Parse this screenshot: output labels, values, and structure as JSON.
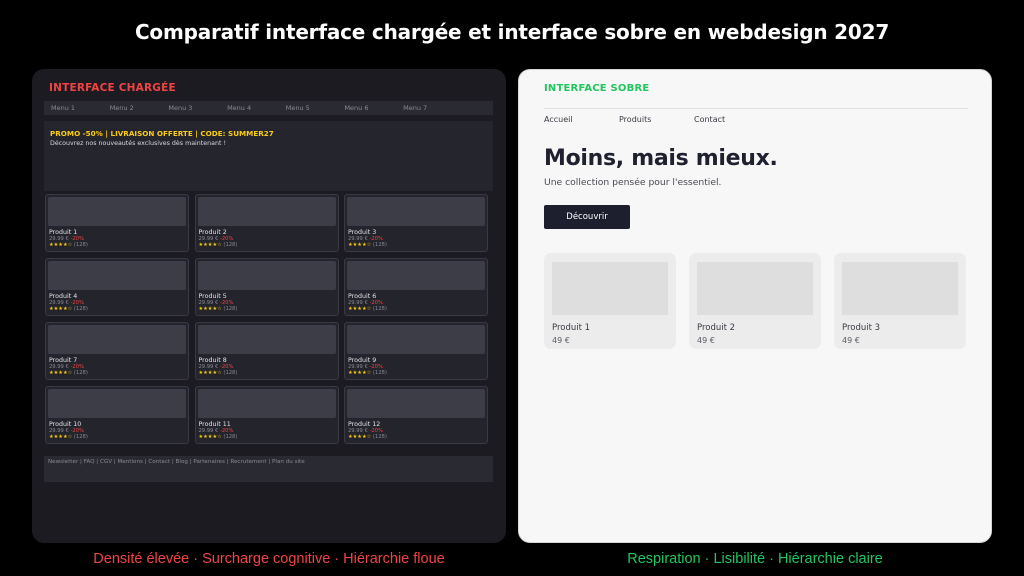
{
  "title": "Comparatif interface chargée et interface sobre en webdesign 2027",
  "left": {
    "heading": "INTERFACE CHARGÉE",
    "menu": [
      "Menu 1",
      "Menu 2",
      "Menu 3",
      "Menu 4",
      "Menu 5",
      "Menu 6",
      "Menu 7"
    ],
    "promo": {
      "title": "PROMO -50% | LIVRAISON OFFERTE | CODE: SUMMER27",
      "subtitle": "Découvrez nos nouveautés exclusives dès maintenant !"
    },
    "products": [
      {
        "name": "Produit 1",
        "price": "29.99 €",
        "discount": "-20%",
        "stars": "★★★★☆",
        "reviews": "(128)"
      },
      {
        "name": "Produit 2",
        "price": "29.99 €",
        "discount": "-20%",
        "stars": "★★★★☆",
        "reviews": "(128)"
      },
      {
        "name": "Produit 3",
        "price": "29.99 €",
        "discount": "-20%",
        "stars": "★★★★☆",
        "reviews": "(128)"
      },
      {
        "name": "Produit 4",
        "price": "29.99 €",
        "discount": "-20%",
        "stars": "★★★★☆",
        "reviews": "(128)"
      },
      {
        "name": "Produit 5",
        "price": "29.99 €",
        "discount": "-20%",
        "stars": "★★★★☆",
        "reviews": "(128)"
      },
      {
        "name": "Produit 6",
        "price": "29.99 €",
        "discount": "-20%",
        "stars": "★★★★☆",
        "reviews": "(128)"
      },
      {
        "name": "Produit 7",
        "price": "29.99 €",
        "discount": "-20%",
        "stars": "★★★★☆",
        "reviews": "(128)"
      },
      {
        "name": "Produit 8",
        "price": "29.99 €",
        "discount": "-20%",
        "stars": "★★★★☆",
        "reviews": "(128)"
      },
      {
        "name": "Produit 9",
        "price": "29.99 €",
        "discount": "-20%",
        "stars": "★★★★☆",
        "reviews": "(128)"
      },
      {
        "name": "Produit 10",
        "price": "29.99 €",
        "discount": "-20%",
        "stars": "★★★★☆",
        "reviews": "(128)"
      },
      {
        "name": "Produit 11",
        "price": "29.99 €",
        "discount": "-20%",
        "stars": "★★★★☆",
        "reviews": "(128)"
      },
      {
        "name": "Produit 12",
        "price": "29.99 €",
        "discount": "-20%",
        "stars": "★★★★☆",
        "reviews": "(128)"
      }
    ],
    "footer": "Newsletter | FAQ | CGV | Mentions | Contact | Blog | Partenaires | Recrutement | Plan du site",
    "caption": "Densité élevée · Surcharge cognitive · Hiérarchie floue"
  },
  "right": {
    "heading": "INTERFACE SOBRE",
    "nav": [
      "Accueil",
      "Produits",
      "Contact"
    ],
    "hero_title": "Moins, mais mieux.",
    "hero_subtitle": "Une collection pensée pour l'essentiel.",
    "cta_label": "Découvrir",
    "products": [
      {
        "name": "Produit 1",
        "price": "49 €"
      },
      {
        "name": "Produit 2",
        "price": "49 €"
      },
      {
        "name": "Produit 3",
        "price": "49 €"
      }
    ],
    "caption": "Respiration · Lisibilité · Hiérarchie claire"
  },
  "colors": {
    "background": "#000000",
    "cluttered_accent": "#ef4444",
    "clean_accent": "#22c55e",
    "promo_accent": "#facc15"
  }
}
